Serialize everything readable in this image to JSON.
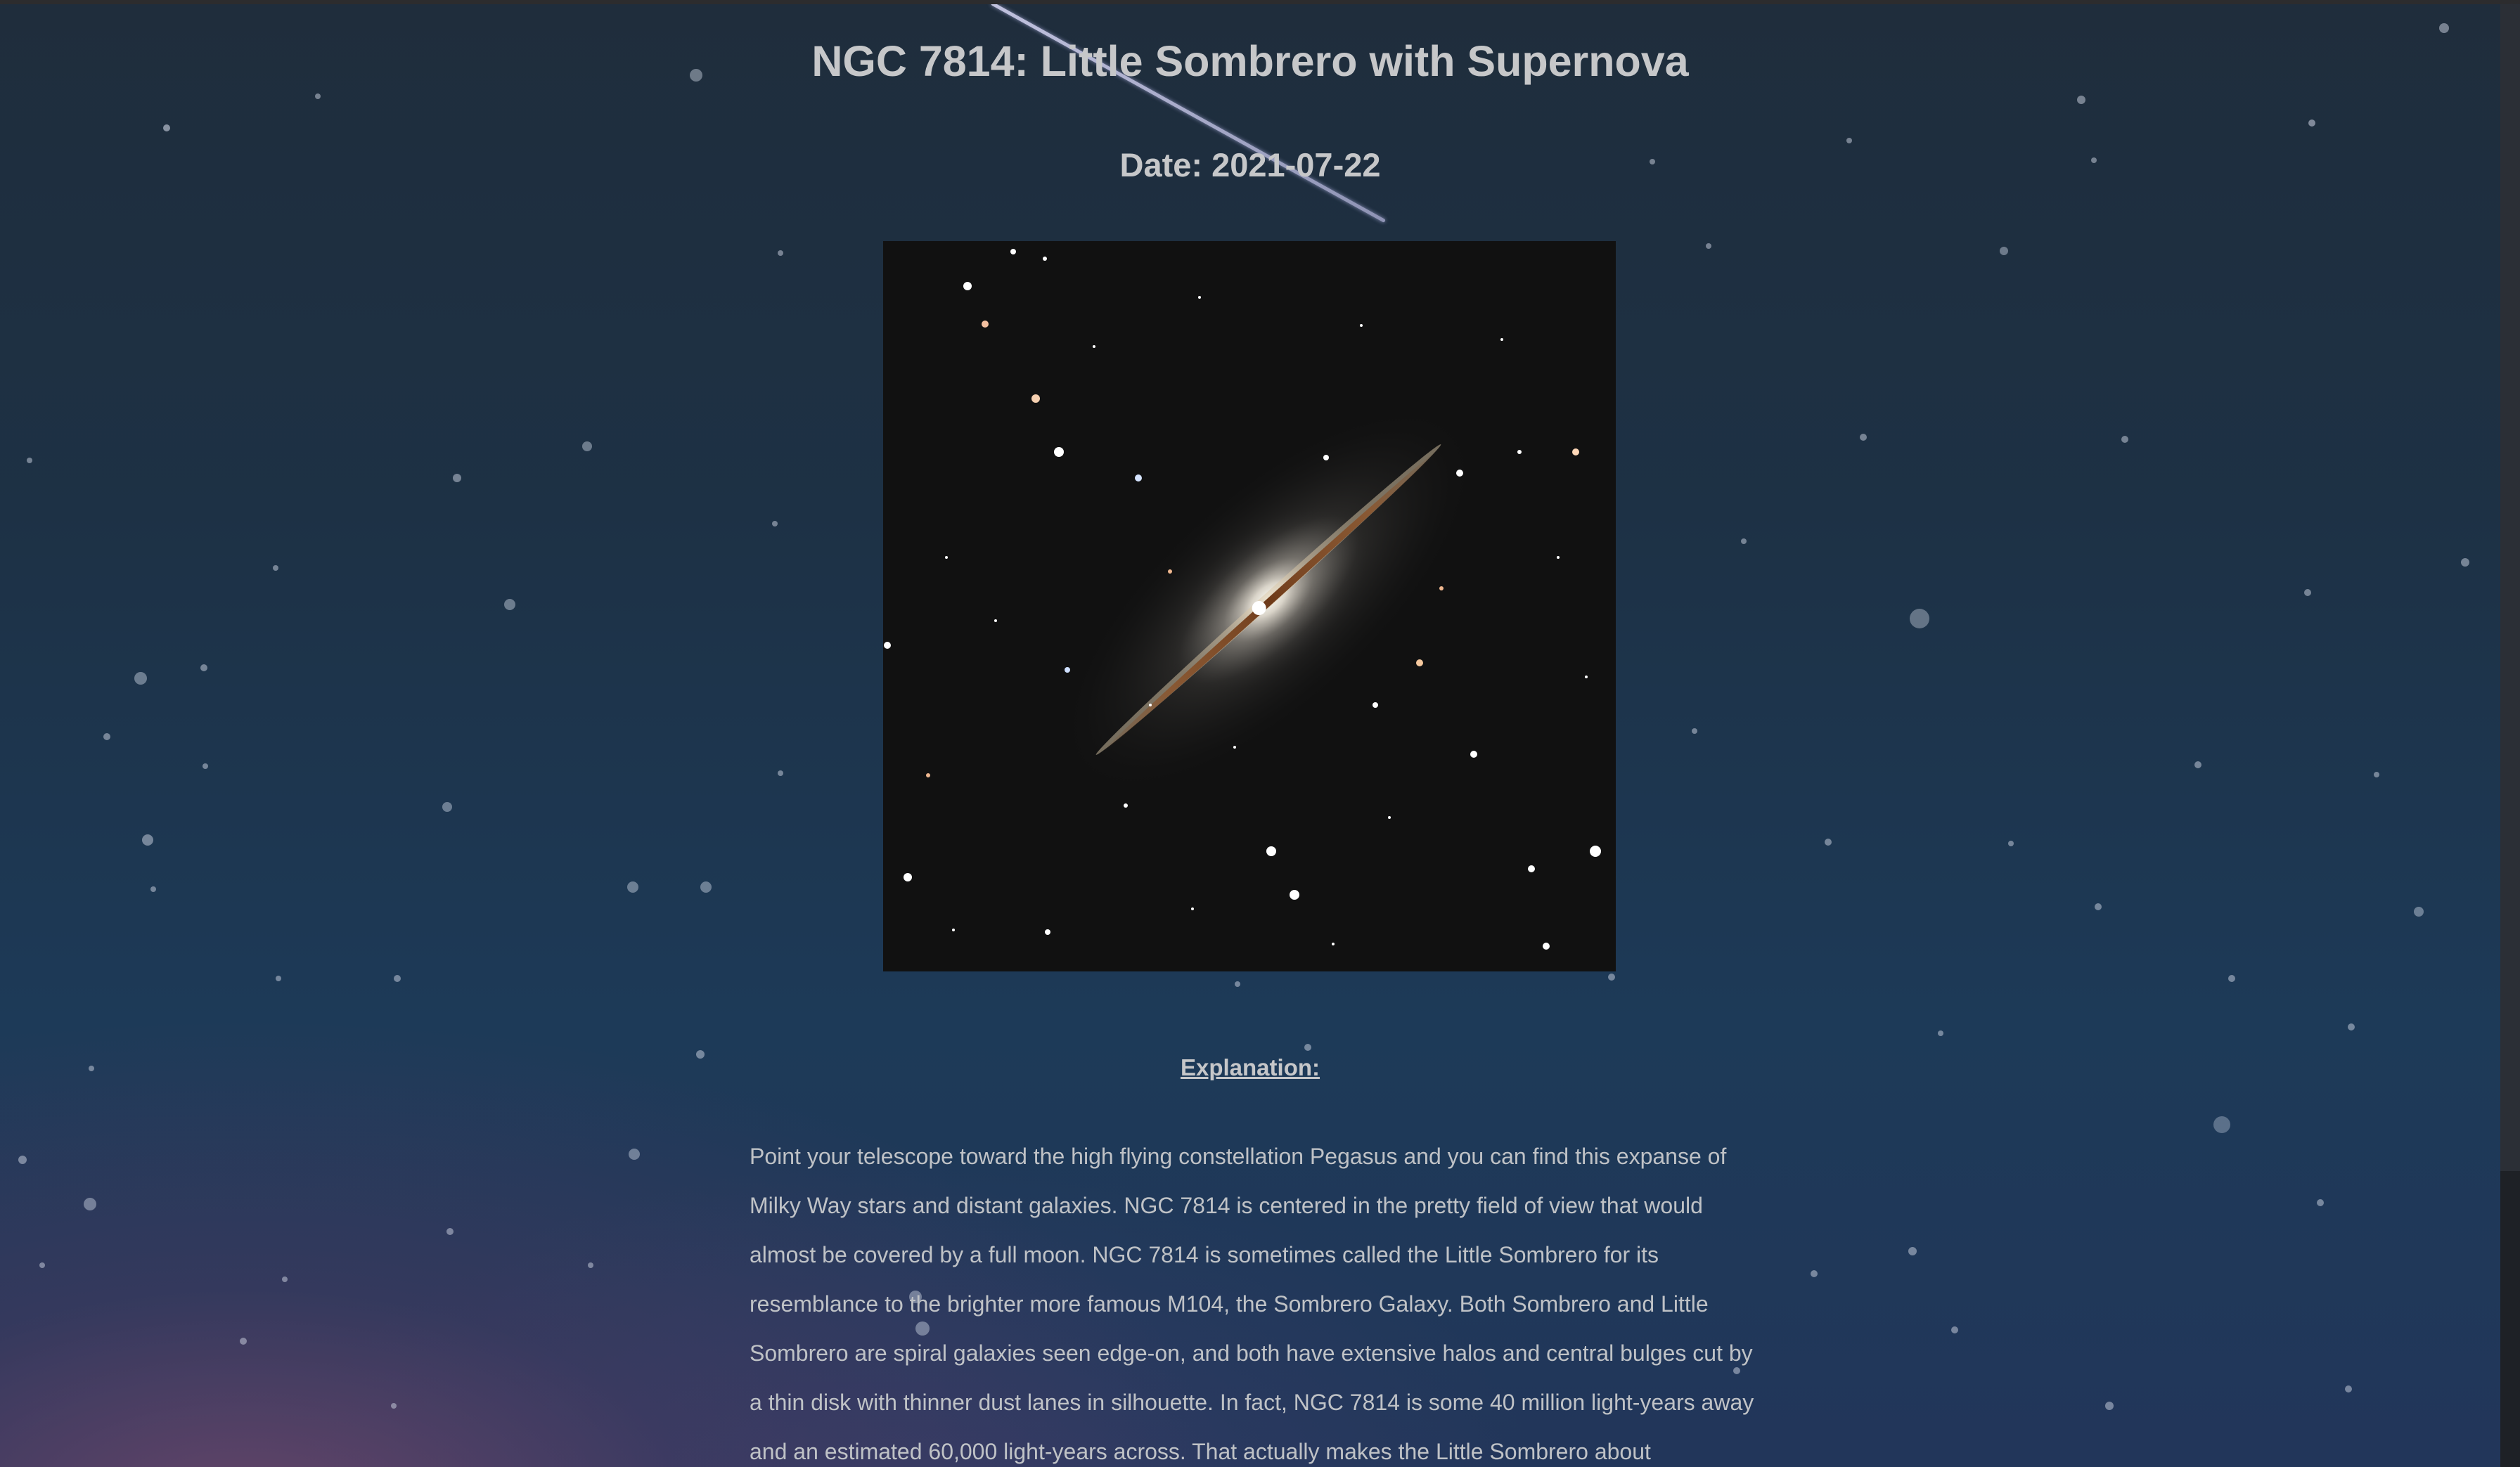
{
  "page": {
    "title": "NGC 7814: Little Sombrero with Supernova",
    "date": "Date: 2021-07-22",
    "image_description": "",
    "explanation_heading": "Explanation:",
    "explanation": "Point your telescope toward the high flying constellation Pegasus and you can find this expanse of Milky Way stars and distant galaxies. NGC 7814 is centered in the pretty field of view that would almost be covered by a full moon. NGC 7814 is sometimes called the Little Sombrero for its resemblance to the brighter more famous M104, the Sombrero Galaxy. Both Sombrero and Little Sombrero are spiral galaxies seen edge-on, and both have extensive halos and central bulges cut by a thin disk with thinner dust lanes in silhouette. In fact, NGC 7814 is some 40 million light-years away and an estimated 60,000 light-years across. That actually makes the Little Sombrero about"
  },
  "colors": {
    "text": "#c6c7c9",
    "background_top": "#1f2d3c",
    "background_bottom": "#22365a",
    "image_background": "#111111"
  }
}
